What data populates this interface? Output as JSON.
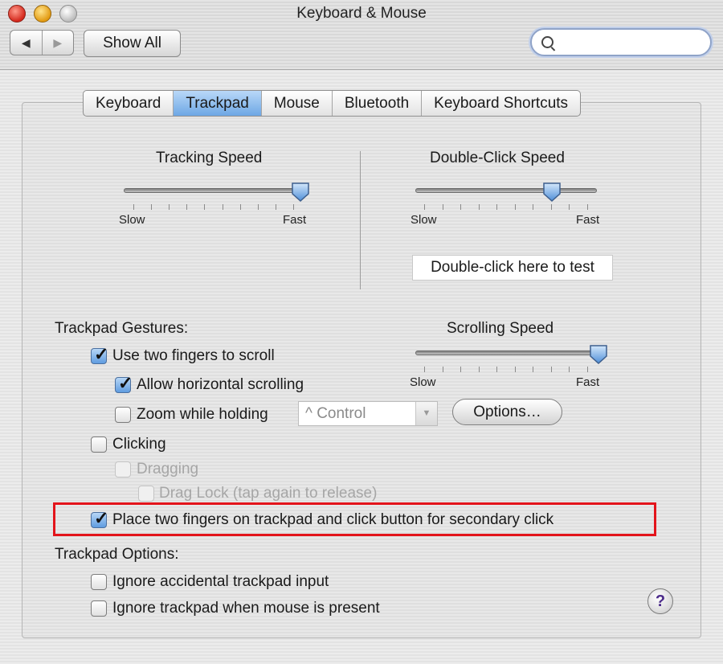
{
  "window": {
    "title": "Keyboard & Mouse"
  },
  "toolbar": {
    "back_glyph": "◀",
    "forward_glyph": "▶",
    "show_all_label": "Show All",
    "search_value": "",
    "search_placeholder": ""
  },
  "tabs": [
    {
      "label": "Keyboard",
      "selected": false
    },
    {
      "label": "Trackpad",
      "selected": true
    },
    {
      "label": "Mouse",
      "selected": false
    },
    {
      "label": "Bluetooth",
      "selected": false
    },
    {
      "label": "Keyboard Shortcuts",
      "selected": false
    }
  ],
  "tracking_speed": {
    "title": "Tracking Speed",
    "min_label": "Slow",
    "max_label": "Fast",
    "value": 1.0
  },
  "double_click_speed": {
    "title": "Double-Click Speed",
    "min_label": "Slow",
    "max_label": "Fast",
    "value": 0.78
  },
  "double_click_test": {
    "label": "Double-click here to test"
  },
  "scrolling_speed": {
    "title": "Scrolling Speed",
    "min_label": "Slow",
    "max_label": "Fast",
    "value": 1.0
  },
  "gestures": {
    "heading": "Trackpad Gestures:",
    "two_finger_scroll": {
      "label": "Use two fingers to scroll",
      "checked": true
    },
    "horizontal_scroll": {
      "label": "Allow horizontal scrolling",
      "checked": true
    },
    "zoom_holding": {
      "label": "Zoom while holding",
      "checked": false
    },
    "zoom_modifier": "^ Control",
    "options_label": "Options…",
    "clicking": {
      "label": "Clicking",
      "checked": false
    },
    "dragging": {
      "label": "Dragging",
      "checked": false
    },
    "drag_lock": {
      "label": "Drag Lock (tap again to release)",
      "checked": false
    },
    "secondary_click": {
      "label": "Place two fingers on trackpad and click button for secondary click",
      "checked": true
    }
  },
  "options": {
    "heading": "Trackpad Options:",
    "ignore_accidental": {
      "label": "Ignore accidental trackpad input",
      "checked": false
    },
    "ignore_with_mouse": {
      "label": "Ignore trackpad when mouse is present",
      "checked": false
    }
  },
  "help": {
    "glyph": "?"
  },
  "colors": {
    "highlight": "#e3141b",
    "selected_tab": "#6da7e4",
    "check_fill": "#5f9ce0"
  },
  "icons": {
    "search": "search-icon",
    "help": "help-icon"
  }
}
